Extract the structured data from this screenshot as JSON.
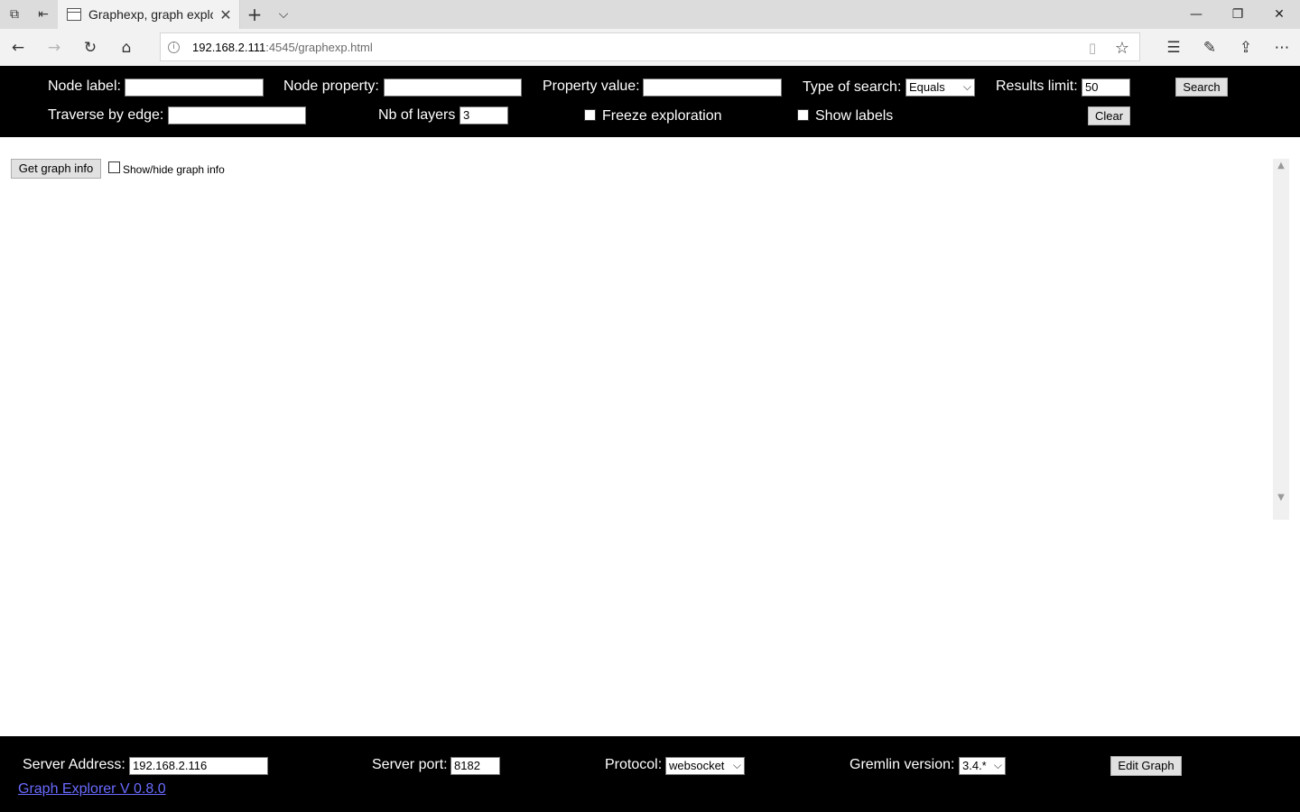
{
  "browser": {
    "tab_title": "Graphexp, graph explor",
    "url_host": "192.168.2.111",
    "url_rest": ":4545/graphexp.html",
    "icons": {
      "tab_actions": "tab-actions-icon",
      "set_aside": "set-aside-tabs-icon",
      "new_tab": "plus-icon",
      "tab_list": "chevron-down-icon",
      "back": "back-arrow-icon",
      "forward": "forward-arrow-icon",
      "refresh": "refresh-icon",
      "home": "home-icon",
      "info": "info-icon",
      "reading_view": "reading-view-icon",
      "favorite": "star-icon",
      "favorites_hub": "favorites-list-icon",
      "notes": "pen-icon",
      "share": "share-icon",
      "more": "more-icon",
      "minimize": "minimize-icon",
      "restore": "restore-icon",
      "close": "close-icon"
    },
    "glyphs": {
      "tab_actions": "⧉",
      "set_aside": "⇤",
      "tab_close": "✕",
      "new_tab": "+",
      "tab_list": "⌵",
      "minimize": "—",
      "restore": "❐",
      "close": "✕",
      "back": "←",
      "forward": "→",
      "refresh": "↻",
      "home": "⌂",
      "info": "i",
      "reading_view": "▯",
      "favorite": "☆",
      "favorites_hub": "☰",
      "notes": "✎",
      "share": "⇪",
      "more": "⋯",
      "select_chevron": "⌵",
      "scroll_up": "▲",
      "scroll_down": "▼"
    }
  },
  "header": {
    "node_label": {
      "label": "Node label:",
      "value": ""
    },
    "node_property": {
      "label": "Node property:",
      "value": ""
    },
    "property_value": {
      "label": "Property value:",
      "value": ""
    },
    "type_of_search": {
      "label": "Type of search:",
      "selected": "Equals"
    },
    "results_limit": {
      "label": "Results limit:",
      "value": "50"
    },
    "search_button": "Search",
    "traverse_by_edge": {
      "label": "Traverse by edge:",
      "value": ""
    },
    "nb_of_layers": {
      "label": "Nb of layers",
      "value": "3"
    },
    "freeze_exploration": {
      "label": "Freeze exploration",
      "checked": false
    },
    "show_labels": {
      "label": "Show labels",
      "checked": false
    },
    "clear_button": "Clear"
  },
  "main": {
    "get_graph_info_button": "Get graph info",
    "show_hide_graph_info": {
      "label": "Show/hide graph info",
      "checked": false
    }
  },
  "footer": {
    "server_address": {
      "label": "Server Address:",
      "value": "192.168.2.116"
    },
    "server_port": {
      "label": "Server port:",
      "value": "8182"
    },
    "protocol": {
      "label": "Protocol:",
      "selected": "websocket"
    },
    "gremlin_version": {
      "label": "Gremlin version:",
      "selected": "3.4.*"
    },
    "edit_graph_button": "Edit Graph",
    "version_link": "Graph Explorer V 0.8.0"
  },
  "colors": {
    "header_bg": "#000000",
    "footer_bg": "#000000",
    "link": "#6a6aff",
    "chrome_bg": "#f2f2f2"
  }
}
